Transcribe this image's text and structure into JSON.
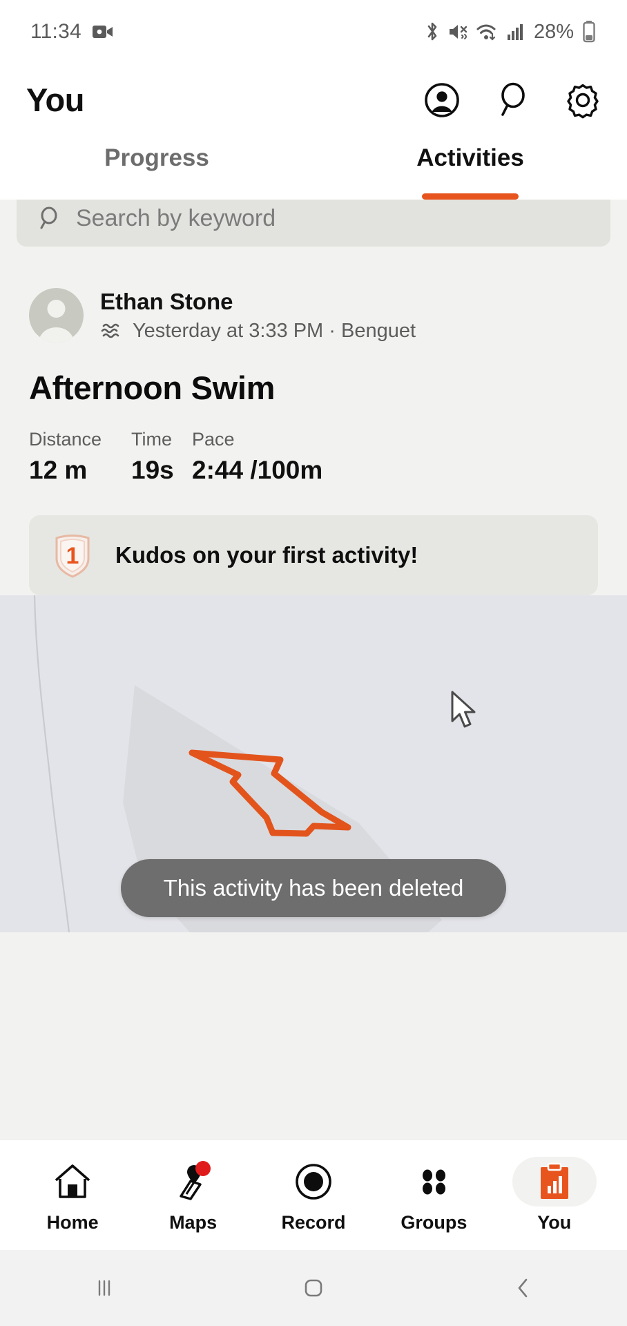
{
  "status_bar": {
    "time": "11:34",
    "battery_percent": "28%",
    "icons": [
      "video-camera-icon",
      "bluetooth-icon",
      "mute-icon",
      "wifi-icon",
      "cellular-signal-icon",
      "battery-icon"
    ]
  },
  "app_bar": {
    "title": "You",
    "actions": [
      "account-circle-icon",
      "search-icon",
      "settings-gear-icon"
    ]
  },
  "tabs": [
    {
      "label": "Progress",
      "active": false
    },
    {
      "label": "Activities",
      "active": true
    }
  ],
  "search": {
    "placeholder": "Search by keyword",
    "icon": "search-icon"
  },
  "activity": {
    "athlete_name": "Ethan Stone",
    "sport_icon": "swim-waves-icon",
    "meta": "Yesterday at 3:33 PM · Benguet",
    "title": "Afternoon Swim",
    "stats": [
      {
        "label": "Distance",
        "value": "12 m"
      },
      {
        "label": "Time",
        "value": "19s"
      },
      {
        "label": "Pace",
        "value": "2:44 /100m"
      }
    ],
    "kudos": {
      "icon": "first-activity-badge-icon",
      "badge_number": "1",
      "text": "Kudos on your first activity!"
    }
  },
  "map": {
    "route_color": "#e2541c",
    "background_color": "#e3e4e9",
    "landmass_color": "#dcdde1"
  },
  "toast": {
    "message": "This activity has been deleted"
  },
  "bottom_nav": [
    {
      "label": "Home",
      "icon": "home-icon",
      "active": false,
      "badge": false
    },
    {
      "label": "Maps",
      "icon": "maps-pin-icon",
      "active": false,
      "badge": true
    },
    {
      "label": "Record",
      "icon": "record-circle-icon",
      "active": false,
      "badge": false
    },
    {
      "label": "Groups",
      "icon": "groups-dots-icon",
      "active": false,
      "badge": false
    },
    {
      "label": "You",
      "icon": "clipboard-chart-icon",
      "active": true,
      "badge": false
    }
  ],
  "system_nav": {
    "recents": "recents-icon",
    "home": "home-square-icon",
    "back": "back-chevron-icon"
  },
  "colors": {
    "accent": "#e8541e",
    "page_bg": "#f2f2f0",
    "toast_bg": "#6e6e6e"
  }
}
